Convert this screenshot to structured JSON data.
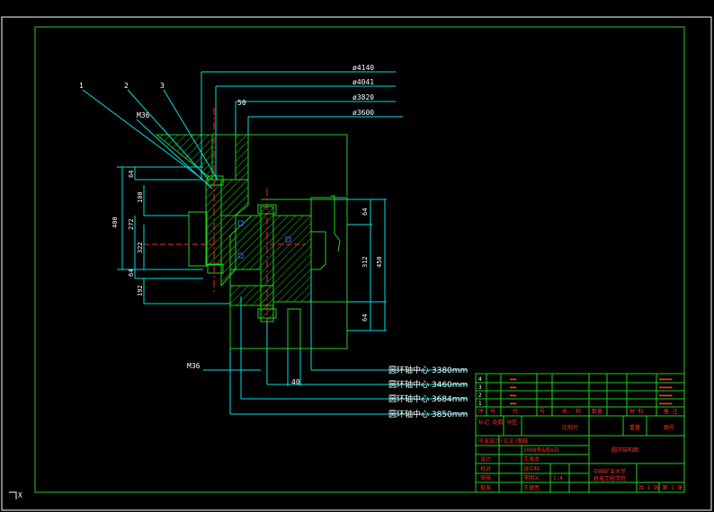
{
  "title_block": {
    "rows": [
      {
        "c0": "4",
        "c1": "▬▬",
        "c3": "▬▬▬▬"
      },
      {
        "c0": "3",
        "c1": "▬▬",
        "c3": "▬▬▬▬"
      },
      {
        "c0": "2",
        "c1": "▬▬",
        "c3": "▬▬▬▬"
      },
      {
        "c0": "1",
        "c1": "▬▬",
        "c3": "▬▬▬▬"
      }
    ],
    "header_row": [
      "序",
      "号",
      "代",
      "号",
      "名",
      "称",
      "数量",
      "材 料",
      "备 注"
    ],
    "scale_label": "比例尺",
    "weight_label": "重量",
    "sheet_label": "图号",
    "drawing_title": "圆环结构图",
    "designer_row": "毕业设计(论文)图纸",
    "date": "2008年6月6日",
    "roles": [
      "设计",
      "校对",
      "审核",
      "批准"
    ],
    "names": [
      "王海龙",
      "张中科",
      "李明义",
      "王德亮"
    ],
    "ratio_label": "1:4",
    "school": [
      "中国矿业大学",
      "机电工程学院"
    ],
    "sheet_count": "共 1 张  第 1 张",
    "bottom_left": "标记 处数 分区"
  },
  "dimensions": {
    "diam_labels": [
      "ø4140",
      "ø4041",
      "ø3820",
      "ø3600"
    ],
    "top_dim": "50",
    "bolt_top": "M36",
    "bolt_bottom": "M36",
    "left_dims": [
      "64",
      "100",
      "400",
      "272",
      "322",
      "64",
      "192"
    ],
    "right_dims": [
      "64",
      "312",
      "450",
      "64"
    ],
    "bottom_dim": "40",
    "part_numbers": [
      "1",
      "2",
      "3"
    ]
  },
  "callouts": [
    {
      "text": "圆环轴中心 3380mm"
    },
    {
      "text": "圆环轴中心 3460mm"
    },
    {
      "text": "圆环轴中心 3684mm"
    },
    {
      "text": "圆环轴中心 3850mm"
    }
  ],
  "ucs_label": "X"
}
